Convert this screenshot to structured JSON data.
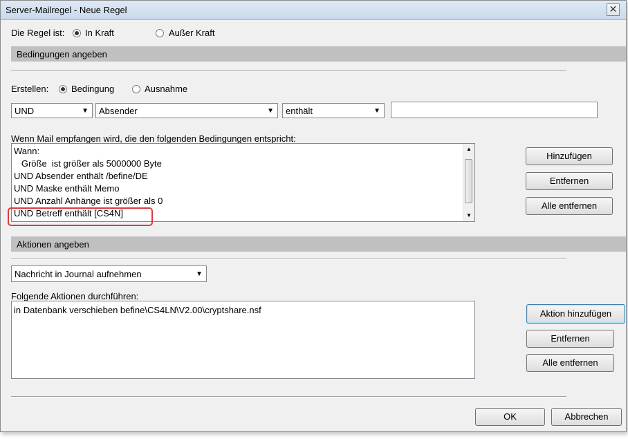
{
  "window": {
    "title": "Server-Mailregel - Neue Regel",
    "close_glyph": "✕"
  },
  "rule_status": {
    "label": "Die Regel ist:",
    "options": [
      "In Kraft",
      "Außer Kraft"
    ],
    "selected": "In Kraft"
  },
  "conditions_section": {
    "header": "Bedingungen angeben",
    "create_label": "Erstellen:",
    "create_options": [
      "Bedingung",
      "Ausnahme"
    ],
    "create_selected": "Bedingung",
    "operator_select": "UND",
    "field_select": "Absender",
    "compare_select": "enthält",
    "value_input": "",
    "list_label": "Wenn Mail empfangen wird, die den folgenden Bedingungen entspricht:",
    "list_lines": [
      "Wann:",
      "   Größe  ist größer als 5000000 Byte",
      "UND Absender enthält /befine/DE",
      "UND Maske enthält Memo",
      "UND Anzahl Anhänge ist größer als 0",
      "UND Betreff enthält [CS4N]"
    ],
    "buttons": {
      "add": "Hinzufügen",
      "remove": "Entfernen",
      "remove_all": "Alle entfernen"
    }
  },
  "actions_section": {
    "header": "Aktionen angeben",
    "action_select": "Nachricht in Journal aufnehmen",
    "list_label": "Folgende Aktionen durchführen:",
    "list_lines": [
      "in Datenbank verschieben befine\\CS4LN\\V2.00\\cryptshare.nsf"
    ],
    "buttons": {
      "add": "Aktion hinzufügen",
      "remove": "Entfernen",
      "remove_all": "Alle entfernen"
    }
  },
  "footer": {
    "ok": "OK",
    "cancel": "Abbrechen"
  },
  "colors": {
    "highlight": "#e03a3a",
    "section_header": "#c0c0c0"
  }
}
